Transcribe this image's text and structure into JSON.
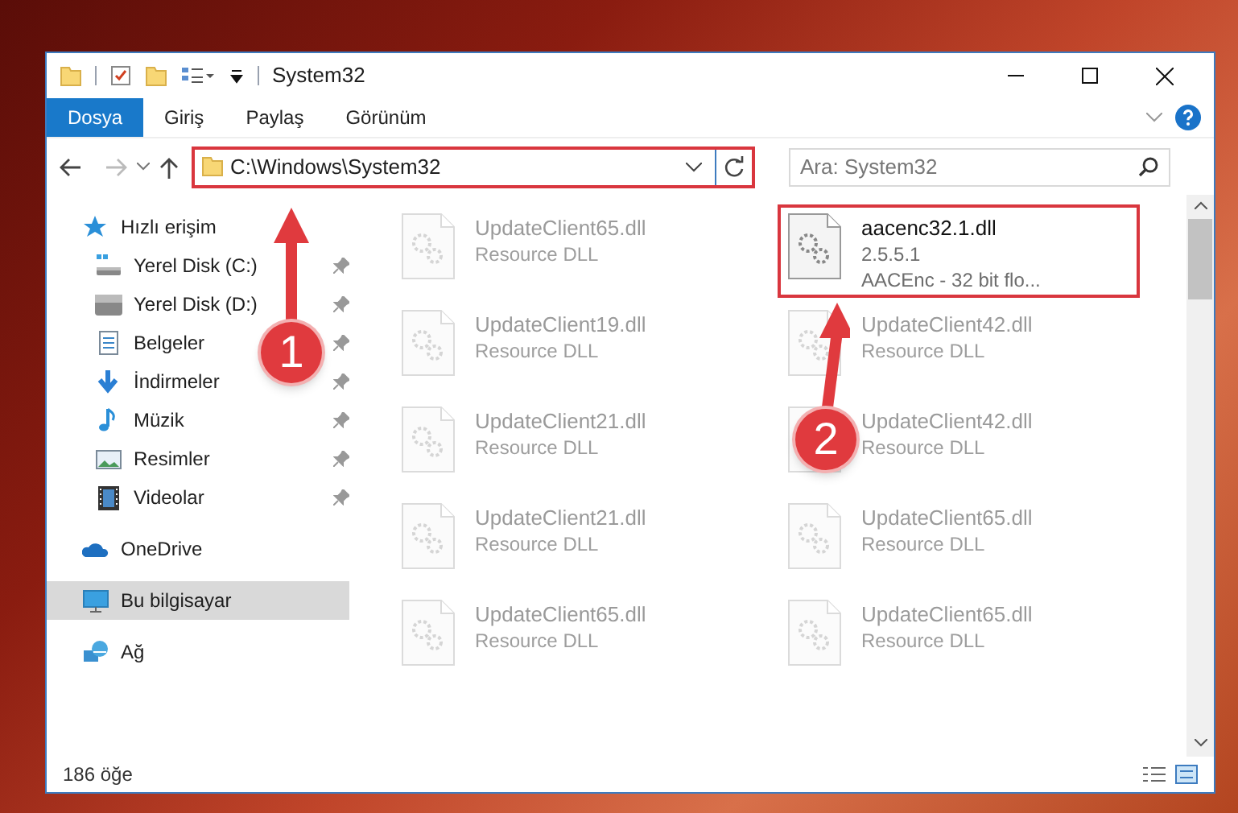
{
  "window": {
    "title": "System32"
  },
  "ribbon_tabs": [
    {
      "label": "Dosya",
      "selected": true
    },
    {
      "label": "Giriş",
      "selected": false
    },
    {
      "label": "Paylaş",
      "selected": false
    },
    {
      "label": "Görünüm",
      "selected": false
    }
  ],
  "address_bar": {
    "path": "C:\\Windows\\System32",
    "highlighted": true
  },
  "search": {
    "placeholder": "Ara: System32"
  },
  "sidebar": {
    "items": [
      {
        "label": "Hızlı erişim",
        "selected": false,
        "children": [
          {
            "label": "Yerel Disk (C:)",
            "pinned": true,
            "selected": false
          },
          {
            "label": "Yerel Disk (D:)",
            "pinned": true,
            "selected": false
          },
          {
            "label": "Belgeler",
            "pinned": true,
            "selected": false
          },
          {
            "label": "İndirmeler",
            "pinned": true,
            "selected": false
          },
          {
            "label": "Müzik",
            "pinned": true,
            "selected": false
          },
          {
            "label": "Resimler",
            "pinned": true,
            "selected": false
          },
          {
            "label": "Videolar",
            "pinned": true,
            "selected": false
          }
        ]
      },
      {
        "label": "OneDrive",
        "selected": false
      },
      {
        "label": "Bu bilgisayar",
        "selected": true
      },
      {
        "label": "Ağ",
        "selected": false
      }
    ]
  },
  "files": [
    {
      "name": "UpdateClient65.dll",
      "details": [
        "Resource DLL"
      ],
      "dimmed": true,
      "highlighted": false
    },
    {
      "name": "aacenc32.1.dll",
      "details": [
        "2.5.5.1",
        "AACEnc - 32 bit flo..."
      ],
      "dimmed": false,
      "highlighted": true
    },
    {
      "name": "UpdateClient19.dll",
      "details": [
        "Resource DLL"
      ],
      "dimmed": true,
      "highlighted": false
    },
    {
      "name": "UpdateClient42.dll",
      "details": [
        "Resource DLL"
      ],
      "dimmed": true,
      "highlighted": false
    },
    {
      "name": "UpdateClient21.dll",
      "details": [
        "Resource DLL"
      ],
      "dimmed": true,
      "highlighted": false
    },
    {
      "name": "UpdateClient42.dll",
      "details": [
        "Resource DLL"
      ],
      "dimmed": true,
      "highlighted": false
    },
    {
      "name": "UpdateClient21.dll",
      "details": [
        "Resource DLL"
      ],
      "dimmed": true,
      "highlighted": false
    },
    {
      "name": "UpdateClient65.dll",
      "details": [
        "Resource DLL"
      ],
      "dimmed": true,
      "highlighted": false
    },
    {
      "name": "UpdateClient65.dll",
      "details": [
        "Resource DLL"
      ],
      "dimmed": true,
      "highlighted": false
    },
    {
      "name": "UpdateClient65.dll",
      "details": [
        "Resource DLL"
      ],
      "dimmed": true,
      "highlighted": false
    }
  ],
  "status_bar": {
    "item_count": "186 öğe"
  },
  "step_markers": [
    {
      "number": "1"
    },
    {
      "number": "2"
    }
  ]
}
